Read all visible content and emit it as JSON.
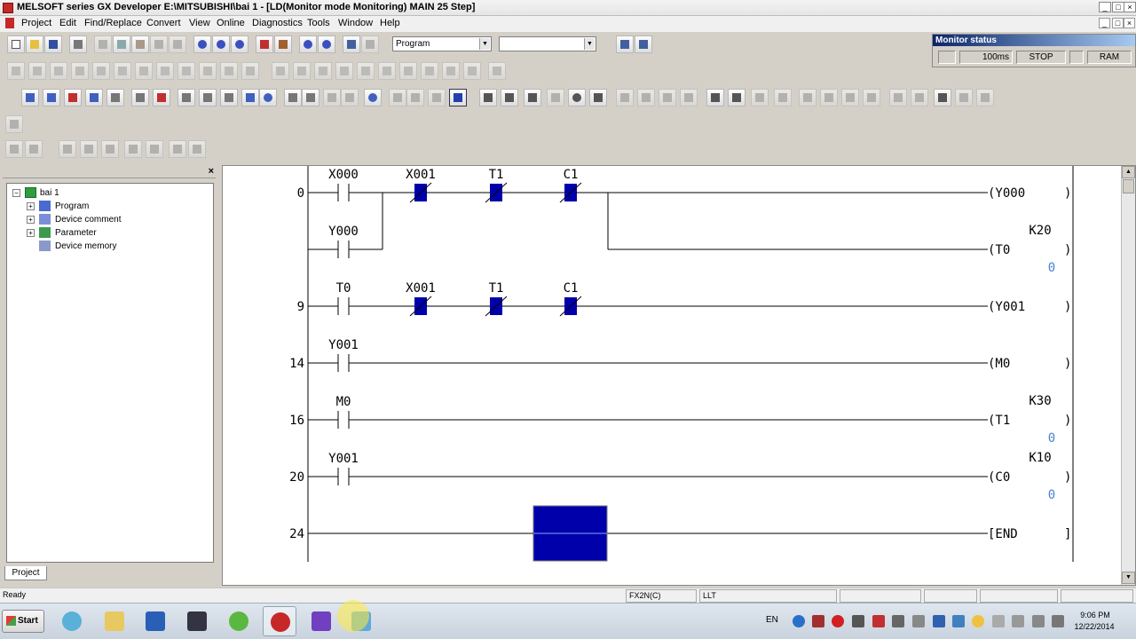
{
  "window": {
    "title": "MELSOFT series GX Developer E:\\MITSUBISHI\\bai 1 - [LD(Monitor mode Monitoring)    MAIN    25 Step]"
  },
  "menu": [
    "Project",
    "Edit",
    "Find/Replace",
    "Convert",
    "View",
    "Online",
    "Diagnostics",
    "Tools",
    "Window",
    "Help"
  ],
  "toolbar": {
    "data_type_value": "Program",
    "second_combo_value": ""
  },
  "monitor_status": {
    "title": "Monitor status",
    "scan_time": "100ms",
    "cpu_state": "STOP",
    "memory": "RAM"
  },
  "project_panel": {
    "root": "bai 1",
    "items": [
      "Program",
      "Device comment",
      "Parameter",
      "Device memory"
    ],
    "tab_label": "Project"
  },
  "ladder": {
    "rungs": [
      {
        "step": "0",
        "contacts": [
          {
            "label": "X000",
            "kind": "NO",
            "monitored": false
          },
          {
            "label": "X001",
            "kind": "NC",
            "monitored": true
          },
          {
            "label": "T1",
            "kind": "NC",
            "monitored": true
          },
          {
            "label": "C1",
            "kind": "NC",
            "monitored": true
          }
        ],
        "branch_contact": {
          "label": "Y000",
          "kind": "NO"
        },
        "coils": [
          {
            "device": "(Y000",
            "setting": "",
            "current": ""
          },
          {
            "device": "(T0",
            "setting": "K20",
            "current": "0"
          }
        ]
      },
      {
        "step": "9",
        "contacts": [
          {
            "label": "T0",
            "kind": "NO",
            "monitored": false
          },
          {
            "label": "X001",
            "kind": "NC",
            "monitored": true
          },
          {
            "label": "T1",
            "kind": "NC",
            "monitored": true
          },
          {
            "label": "C1",
            "kind": "NC",
            "monitored": true
          }
        ],
        "coils": [
          {
            "device": "(Y001",
            "setting": "",
            "current": ""
          }
        ]
      },
      {
        "step": "14",
        "contacts": [
          {
            "label": "Y001",
            "kind": "NO",
            "monitored": false
          }
        ],
        "coils": [
          {
            "device": "(M0",
            "setting": "",
            "current": ""
          }
        ]
      },
      {
        "step": "16",
        "contacts": [
          {
            "label": "M0",
            "kind": "NO",
            "monitored": false
          }
        ],
        "coils": [
          {
            "device": "(T1",
            "setting": "K30",
            "current": "0"
          }
        ]
      },
      {
        "step": "20",
        "contacts": [
          {
            "label": "Y001",
            "kind": "NO",
            "monitored": false
          }
        ],
        "coils": [
          {
            "device": "(C0",
            "setting": "K10",
            "current": "0"
          }
        ]
      },
      {
        "step": "24",
        "contacts": [],
        "coils": [
          {
            "device": "[END",
            "setting": "",
            "current": ""
          }
        ]
      }
    ]
  },
  "statusbar": {
    "message": "Ready",
    "plc_type": "FX2N(C)",
    "mode": "LLT"
  },
  "taskbar": {
    "start_label": "Start",
    "language": "EN",
    "time": "9:06 PM",
    "date": "12/22/2014"
  },
  "colors": {
    "monitor_on": "#0000aa",
    "ladder_line": "#000000",
    "current_value": "#4a7fd4"
  }
}
